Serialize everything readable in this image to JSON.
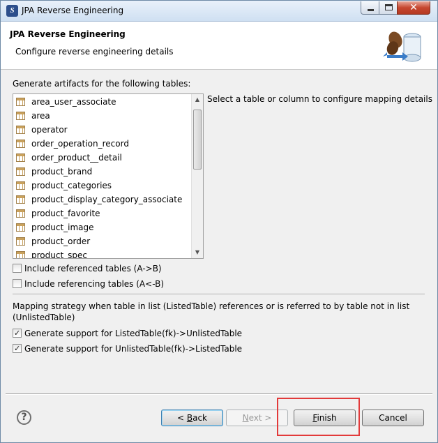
{
  "window": {
    "title": "JPA Reverse Engineering",
    "controls": {
      "minimize": "minimize",
      "maximize": "maximize",
      "close": "✕"
    }
  },
  "header": {
    "title": "JPA Reverse Engineering",
    "subtitle": "Configure reverse engineering details"
  },
  "tables_section": {
    "label": "Generate artifacts for the following tables:",
    "hint": "Select a table or column to configure mapping details",
    "tables": [
      "area_user_associate",
      "area",
      "operator",
      "order_operation_record",
      "order_product__detail",
      "product_brand",
      "product_categories",
      "product_display_category_associate",
      "product_favorite",
      "product_image",
      "product_order",
      "product_spec"
    ]
  },
  "options": {
    "include_referenced": {
      "label": "Include referenced tables (A->B)",
      "checked": false
    },
    "include_referencing": {
      "label": "Include referencing tables (A<-B)",
      "checked": false
    }
  },
  "strategy": {
    "text": "Mapping strategy when table in list (ListedTable) references or is referred to by table not in list (UnlistedTable)",
    "listed_to_unlisted": {
      "label": "Generate support for ListedTable(fk)->UnlistedTable",
      "checked": true
    },
    "unlisted_to_listed": {
      "label": "Generate support for UnlistedTable(fk)->ListedTable",
      "checked": true
    }
  },
  "footer": {
    "help_glyph": "?",
    "back_label_pre": "< ",
    "back_label_mnemonic": "B",
    "back_label_post": "ack",
    "next_label_mnemonic": "N",
    "next_label_post": "ext >",
    "finish_label_mnemonic": "F",
    "finish_label_post": "inish",
    "cancel_label": "Cancel"
  },
  "colors": {
    "highlight": "#e23a3a",
    "accent": "#3c7fb1"
  }
}
